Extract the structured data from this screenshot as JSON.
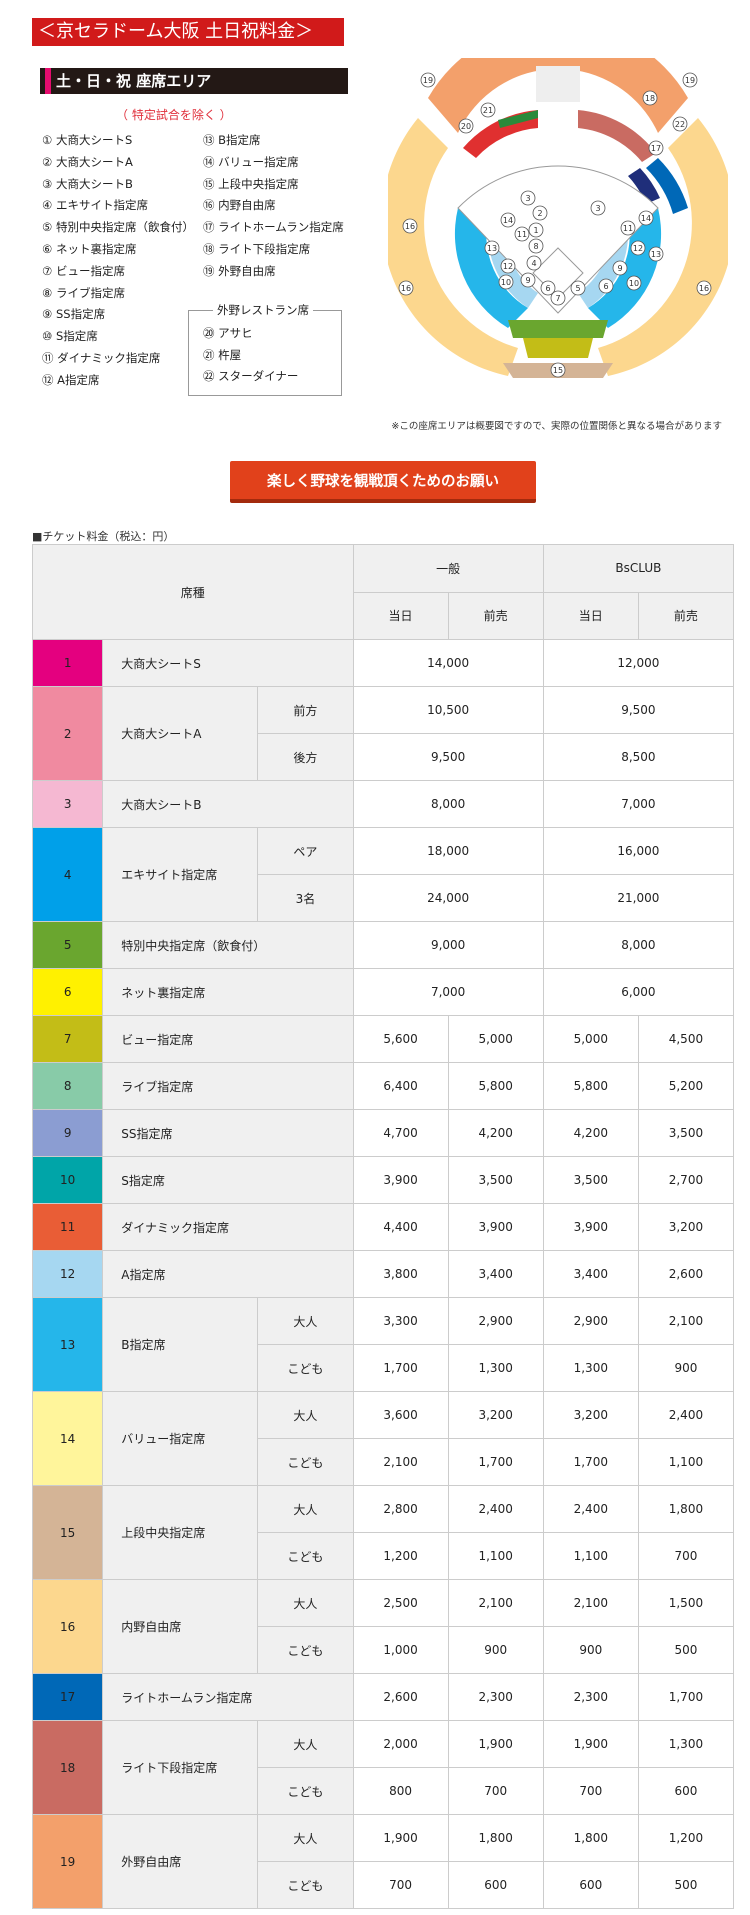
{
  "header": {
    "title": "＜京セラドーム大阪 土日祝料金＞",
    "subtitle": "土・日・祝 座席エリア",
    "exclusion": "（  特定試合を除く  ）"
  },
  "legend": {
    "left": [
      "①  大商大シートS",
      "②  大商大シートA",
      "③  大商大シートB",
      "④  エキサイト指定席",
      "⑤  特別中央指定席（飲食付）",
      "⑥  ネット裏指定席",
      "⑦  ビュー指定席",
      "⑧  ライブ指定席",
      "⑨  SS指定席",
      "⑩  S指定席",
      "⑪  ダイナミック指定席",
      "⑫  A指定席"
    ],
    "right": [
      "⑬  B指定席",
      "⑭  バリュー指定席",
      "⑮  上段中央指定席",
      "⑯  内野自由席",
      "⑰  ライトホームラン指定席",
      "⑱  ライト下段指定席",
      "⑲  外野自由席"
    ],
    "restaurant_title": "外野レストラン席",
    "restaurants": [
      "⑳  アサヒ",
      "㉑  杵屋",
      "㉒  スターダイナー"
    ]
  },
  "map": {
    "note": "※この座席エリアは概要図ですので、実際の位置関係と異なる場合があります",
    "labels": [
      "19",
      "19",
      "20",
      "21",
      "18",
      "22",
      "17",
      "16",
      "16",
      "16",
      "3",
      "2",
      "14",
      "11",
      "1",
      "13",
      "8",
      "12",
      "4",
      "10",
      "9",
      "6",
      "5",
      "7",
      "11",
      "12",
      "9",
      "6",
      "10",
      "13",
      "14",
      "3",
      "15"
    ]
  },
  "button": {
    "label": "楽しく野球を観戦頂くためのお願い"
  },
  "price": {
    "heading": "■チケット料金（税込：円）",
    "headers": {
      "seat": "席種",
      "general": "一般",
      "club": "BsCLUB",
      "same_day": "当日",
      "advance": "前売"
    },
    "rows": [
      {
        "no": "1",
        "name": "大商大シートS",
        "color": "#e4007f",
        "text": "#222",
        "sub": [
          {
            "label": "",
            "v": [
              "14,000",
              "12,000"
            ]
          }
        ]
      },
      {
        "no": "2",
        "name": "大商大シートA",
        "color": "#f08aa0",
        "text": "#222",
        "sub": [
          {
            "label": "前方",
            "v": [
              "10,500",
              "9,500"
            ]
          },
          {
            "label": "後方",
            "v": [
              "9,500",
              "8,500"
            ]
          }
        ]
      },
      {
        "no": "3",
        "name": "大商大シートB",
        "color": "#f5b8d2",
        "text": "#222",
        "sub": [
          {
            "label": "",
            "v": [
              "8,000",
              "7,000"
            ]
          }
        ]
      },
      {
        "no": "4",
        "name": "エキサイト指定席",
        "color": "#00a0e9",
        "text": "#222",
        "sub": [
          {
            "label": "ペア",
            "v": [
              "18,000",
              "16,000"
            ]
          },
          {
            "label": "3名",
            "v": [
              "24,000",
              "21,000"
            ]
          }
        ]
      },
      {
        "no": "5",
        "name": "特別中央指定席（飲食付）",
        "color": "#6aa62f",
        "text": "#222",
        "sub": [
          {
            "label": "",
            "v": [
              "9,000",
              "8,000"
            ]
          }
        ]
      },
      {
        "no": "6",
        "name": "ネット裏指定席",
        "color": "#fff100",
        "text": "#222",
        "sub": [
          {
            "label": "",
            "v": [
              "7,000",
              "6,000"
            ]
          }
        ]
      },
      {
        "no": "7",
        "name": "ビュー指定席",
        "color": "#c3bd17",
        "text": "#222",
        "sub": [
          {
            "label": "",
            "v": [
              "5,600",
              "5,000",
              "5,000",
              "4,500"
            ]
          }
        ]
      },
      {
        "no": "8",
        "name": "ライブ指定席",
        "color": "#88cba8",
        "text": "#222",
        "sub": [
          {
            "label": "",
            "v": [
              "6,400",
              "5,800",
              "5,800",
              "5,200"
            ]
          }
        ]
      },
      {
        "no": "9",
        "name": "SS指定席",
        "color": "#8b9dd2",
        "text": "#222",
        "sub": [
          {
            "label": "",
            "v": [
              "4,700",
              "4,200",
              "4,200",
              "3,500"
            ]
          }
        ]
      },
      {
        "no": "10",
        "name": "S指定席",
        "color": "#00a5a8",
        "text": "#222",
        "sub": [
          {
            "label": "",
            "v": [
              "3,900",
              "3,500",
              "3,500",
              "2,700"
            ]
          }
        ]
      },
      {
        "no": "11",
        "name": "ダイナミック指定席",
        "color": "#e95d36",
        "text": "#222",
        "sub": [
          {
            "label": "",
            "v": [
              "4,400",
              "3,900",
              "3,900",
              "3,200"
            ]
          }
        ]
      },
      {
        "no": "12",
        "name": "A指定席",
        "color": "#a6d7f1",
        "text": "#222",
        "sub": [
          {
            "label": "",
            "v": [
              "3,800",
              "3,400",
              "3,400",
              "2,600"
            ]
          }
        ]
      },
      {
        "no": "13",
        "name": "B指定席",
        "color": "#25b6ea",
        "text": "#222",
        "sub": [
          {
            "label": "大人",
            "v": [
              "3,300",
              "2,900",
              "2,900",
              "2,100"
            ]
          },
          {
            "label": "こども",
            "v": [
              "1,700",
              "1,300",
              "1,300",
              "900"
            ]
          }
        ]
      },
      {
        "no": "14",
        "name": "バリュー指定席",
        "color": "#fff59b",
        "text": "#222",
        "sub": [
          {
            "label": "大人",
            "v": [
              "3,600",
              "3,200",
              "3,200",
              "2,400"
            ]
          },
          {
            "label": "こども",
            "v": [
              "2,100",
              "1,700",
              "1,700",
              "1,100"
            ]
          }
        ]
      },
      {
        "no": "15",
        "name": "上段中央指定席",
        "color": "#d4b496",
        "text": "#222",
        "sub": [
          {
            "label": "大人",
            "v": [
              "2,800",
              "2,400",
              "2,400",
              "1,800"
            ]
          },
          {
            "label": "こども",
            "v": [
              "1,200",
              "1,100",
              "1,100",
              "700"
            ]
          }
        ]
      },
      {
        "no": "16",
        "name": "内野自由席",
        "color": "#fcd78e",
        "text": "#222",
        "sub": [
          {
            "label": "大人",
            "v": [
              "2,500",
              "2,100",
              "2,100",
              "1,500"
            ]
          },
          {
            "label": "こども",
            "v": [
              "1,000",
              "900",
              "900",
              "500"
            ]
          }
        ]
      },
      {
        "no": "17",
        "name": "ライトホームラン指定席",
        "color": "#0068b7",
        "text": "#222",
        "sub": [
          {
            "label": "",
            "v": [
              "2,600",
              "2,300",
              "2,300",
              "1,700"
            ]
          }
        ]
      },
      {
        "no": "18",
        "name": "ライト下段指定席",
        "color": "#c96b62",
        "text": "#222",
        "sub": [
          {
            "label": "大人",
            "v": [
              "2,000",
              "1,900",
              "1,900",
              "1,300"
            ]
          },
          {
            "label": "こども",
            "v": [
              "800",
              "700",
              "700",
              "600"
            ]
          }
        ]
      },
      {
        "no": "19",
        "name": "外野自由席",
        "color": "#f3a06b",
        "text": "#222",
        "sub": [
          {
            "label": "大人",
            "v": [
              "1,900",
              "1,800",
              "1,800",
              "1,200"
            ]
          },
          {
            "label": "こども",
            "v": [
              "700",
              "600",
              "600",
              "500"
            ]
          }
        ]
      }
    ]
  }
}
